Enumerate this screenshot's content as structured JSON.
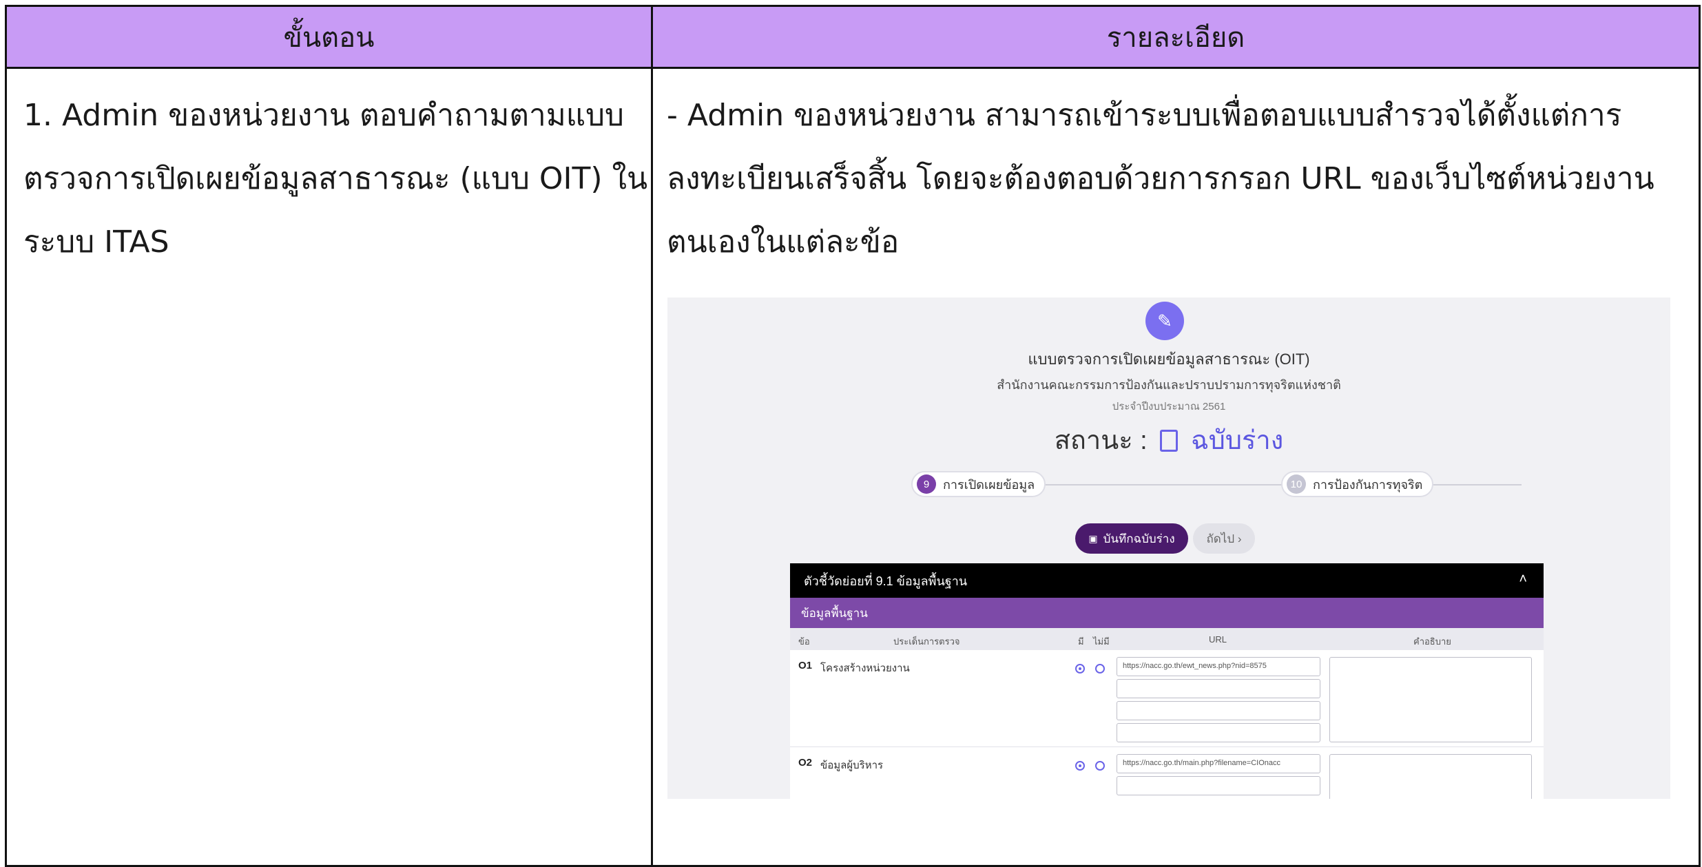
{
  "table": {
    "header": {
      "col1": "ขั้นตอน",
      "col2": "รายละเอียด"
    },
    "step": {
      "lines": [
        "1. Admin ของหน่วยงาน ตอบคำถามตามแบบ",
        "ตรวจการเปิดเผยข้อมูลสาธารณะ (แบบ OIT) ใน",
        "ระบบ ITAS"
      ]
    },
    "detail": {
      "lines": [
        "- Admin ของหน่วยงาน สามารถเข้าระบบเพื่อตอบแบบสำรวจได้ตั้งแต่การ",
        "ลงทะเบียนเสร็จสิ้น โดยจะต้องตอบด้วยการกรอก URL ของเว็บไซต์หน่วยงาน",
        "ตนเองในแต่ละข้อ"
      ]
    }
  },
  "screenshot": {
    "title": "แบบตรวจการเปิดเผยข้อมูลสาธารณะ (OIT)",
    "agency": "สำนักงานคณะกรรมการป้องกันและปราบปรามการทุจริตแห่งชาติ",
    "fiscal_year": "ประจำปีงบประมาณ 2561",
    "status_label": "สถานะ :",
    "status_value": "ฉบับร่าง",
    "steps": [
      {
        "num": "9",
        "label": "การเปิดเผยข้อมูล"
      },
      {
        "num": "10",
        "label": "การป้องกันการทุจริต"
      }
    ],
    "save_button": "บันทึกฉบับร่าง",
    "next_button": "ถัดไป ›",
    "panel_title": "ตัวชี้วัดย่อยที่ 9.1 ข้อมูลพื้นฐาน",
    "panel_subtitle": "ข้อมูลพื้นฐาน",
    "columns": {
      "no": "ข้อ",
      "issue": "ประเด็นการตรวจ",
      "yes": "มี",
      "no_have": "ไม่มี",
      "url": "URL",
      "desc": "คำอธิบาย"
    },
    "rows": [
      {
        "num": "O1",
        "issue": "โครงสร้างหน่วยงาน",
        "url": "https://nacc.go.th/ewt_news.php?nid=8575",
        "selected": "yes"
      },
      {
        "num": "O2",
        "issue": "ข้อมูลผู้บริหาร",
        "url": "https://nacc.go.th/main.php?filename=CIOnacc",
        "selected": "yes"
      }
    ]
  }
}
